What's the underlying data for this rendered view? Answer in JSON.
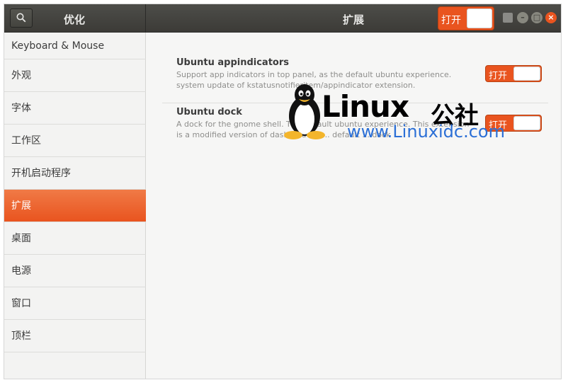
{
  "header": {
    "app_title": "优化",
    "page_title": "扩展",
    "global_switch_label": "打开"
  },
  "sidebar": {
    "items": [
      {
        "label": "Keyboard & Mouse"
      },
      {
        "label": "外观"
      },
      {
        "label": "字体"
      },
      {
        "label": "工作区"
      },
      {
        "label": "开机启动程序"
      },
      {
        "label": "扩展",
        "selected": true
      },
      {
        "label": "桌面"
      },
      {
        "label": "电源"
      },
      {
        "label": "窗口"
      },
      {
        "label": "顶栏"
      }
    ]
  },
  "extensions": [
    {
      "title": "Ubuntu appindicators",
      "description": "Support app indicators in top panel, as the default ubuntu experience. system update of kstatusnotifieritem/appindicator extension.",
      "switch_label": "打开"
    },
    {
      "title": "Ubuntu dock",
      "description": "A dock for the gnome shell. This default ubuntu experience. This extension is a modified version of dash to dock ... default ... dock",
      "switch_label": "打开"
    }
  ],
  "watermark": {
    "brand": "Linux",
    "brand_cn": "公社",
    "url": "www.Linuxidc.com"
  },
  "colors": {
    "accent": "#e9541f",
    "headerbar": "#3c3b37",
    "selected_row": "#ee6a33"
  }
}
